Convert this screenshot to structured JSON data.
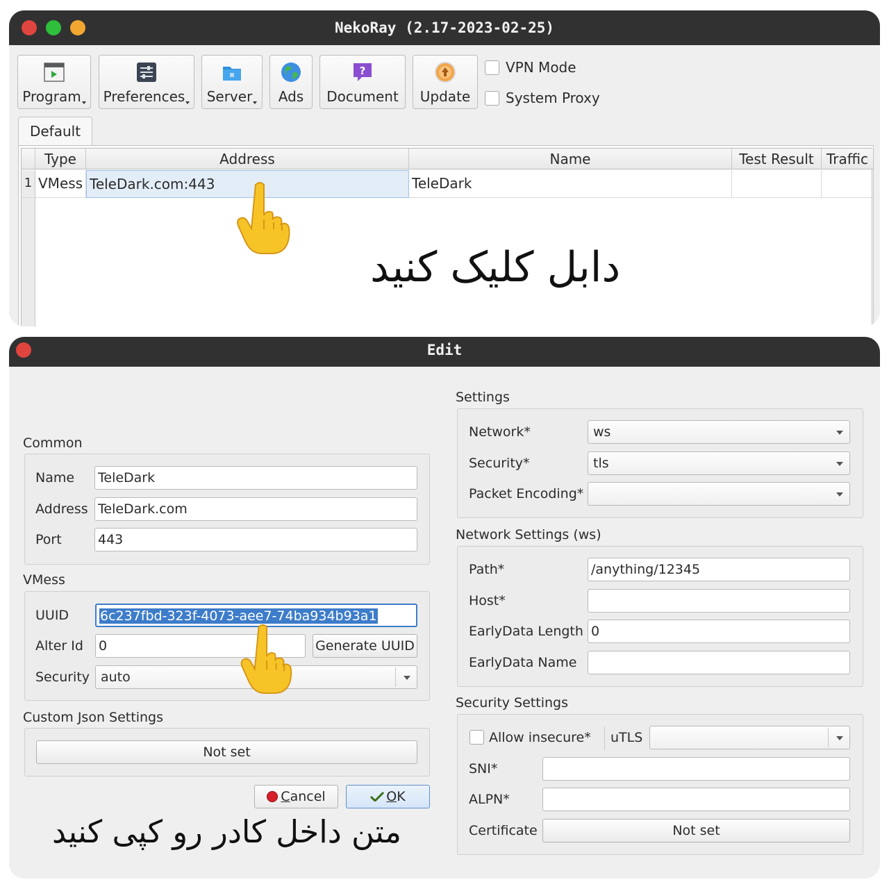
{
  "main_window": {
    "title": "NekoRay (2.17-2023-02-25)",
    "toolbar": {
      "program": "Program",
      "preferences": "Preferences",
      "server": "Server",
      "ads": "Ads",
      "document": "Document",
      "update": "Update"
    },
    "vpn_mode_label": "VPN Mode",
    "vpn_mode_checked": false,
    "system_proxy_label": "System Proxy",
    "system_proxy_checked": false,
    "tab": "Default",
    "table": {
      "columns": [
        "Type",
        "Address",
        "Name",
        "Test Result",
        "Traffic"
      ],
      "rows": [
        {
          "num": "1",
          "type": "VMess",
          "address": "TeleDark.com:443",
          "name": "TeleDark",
          "test_result": "",
          "traffic": ""
        }
      ]
    }
  },
  "overlay_text_1": "دابل کلیک کنید",
  "overlay_text_2": "متن داخل کادر رو کپی کنید",
  "edit_dialog": {
    "title": "Edit",
    "common": {
      "label": "Common",
      "name_label": "Name",
      "name_value": "TeleDark",
      "address_label": "Address",
      "address_value": "TeleDark.com",
      "port_label": "Port",
      "port_value": "443"
    },
    "vmess": {
      "label": "VMess",
      "uuid_label": "UUID",
      "uuid_value": "6c237fbd-323f-4073-aee7-74ba934b93a1",
      "alter_id_label": "Alter Id",
      "alter_id_value": "0",
      "generate_uuid": "Generate UUID",
      "security_label": "Security",
      "security_value": "auto"
    },
    "custom_json": {
      "label": "Custom Json Settings",
      "button": "Not set"
    },
    "cancel": "Cancel",
    "ok": "OK",
    "settings": {
      "label": "Settings",
      "network_label": "Network*",
      "network_value": "ws",
      "security_label": "Security*",
      "security_value": "tls",
      "packet_encoding_label": "Packet Encoding*",
      "packet_encoding_value": ""
    },
    "network_settings": {
      "label": "Network Settings (ws)",
      "path_label": "Path*",
      "path_value": "/anything/12345",
      "host_label": "Host*",
      "host_value": "",
      "earlydata_length_label": "EarlyData Length",
      "earlydata_length_value": "0",
      "earlydata_name_label": "EarlyData Name",
      "earlydata_name_value": ""
    },
    "security_settings": {
      "label": "Security Settings",
      "allow_insecure_label": "Allow insecure*",
      "allow_insecure_checked": false,
      "utls_label": "uTLS",
      "utls_value": "",
      "sni_label": "SNI*",
      "sni_value": "",
      "alpn_label": "ALPN*",
      "alpn_value": "",
      "certificate_label": "Certificate",
      "certificate_button": "Not set"
    }
  },
  "colors": {
    "titlebar": "#313131",
    "close": "#e0443e",
    "minimize": "#2ebf3c",
    "maximize": "#f3a731",
    "selection": "#3d7cc9",
    "window_bg": "#efefef"
  },
  "icons": [
    "program-icon",
    "preferences-icon",
    "server-icon",
    "ads-globe-icon",
    "document-help-icon",
    "update-icon",
    "pointing-hand-icon"
  ]
}
